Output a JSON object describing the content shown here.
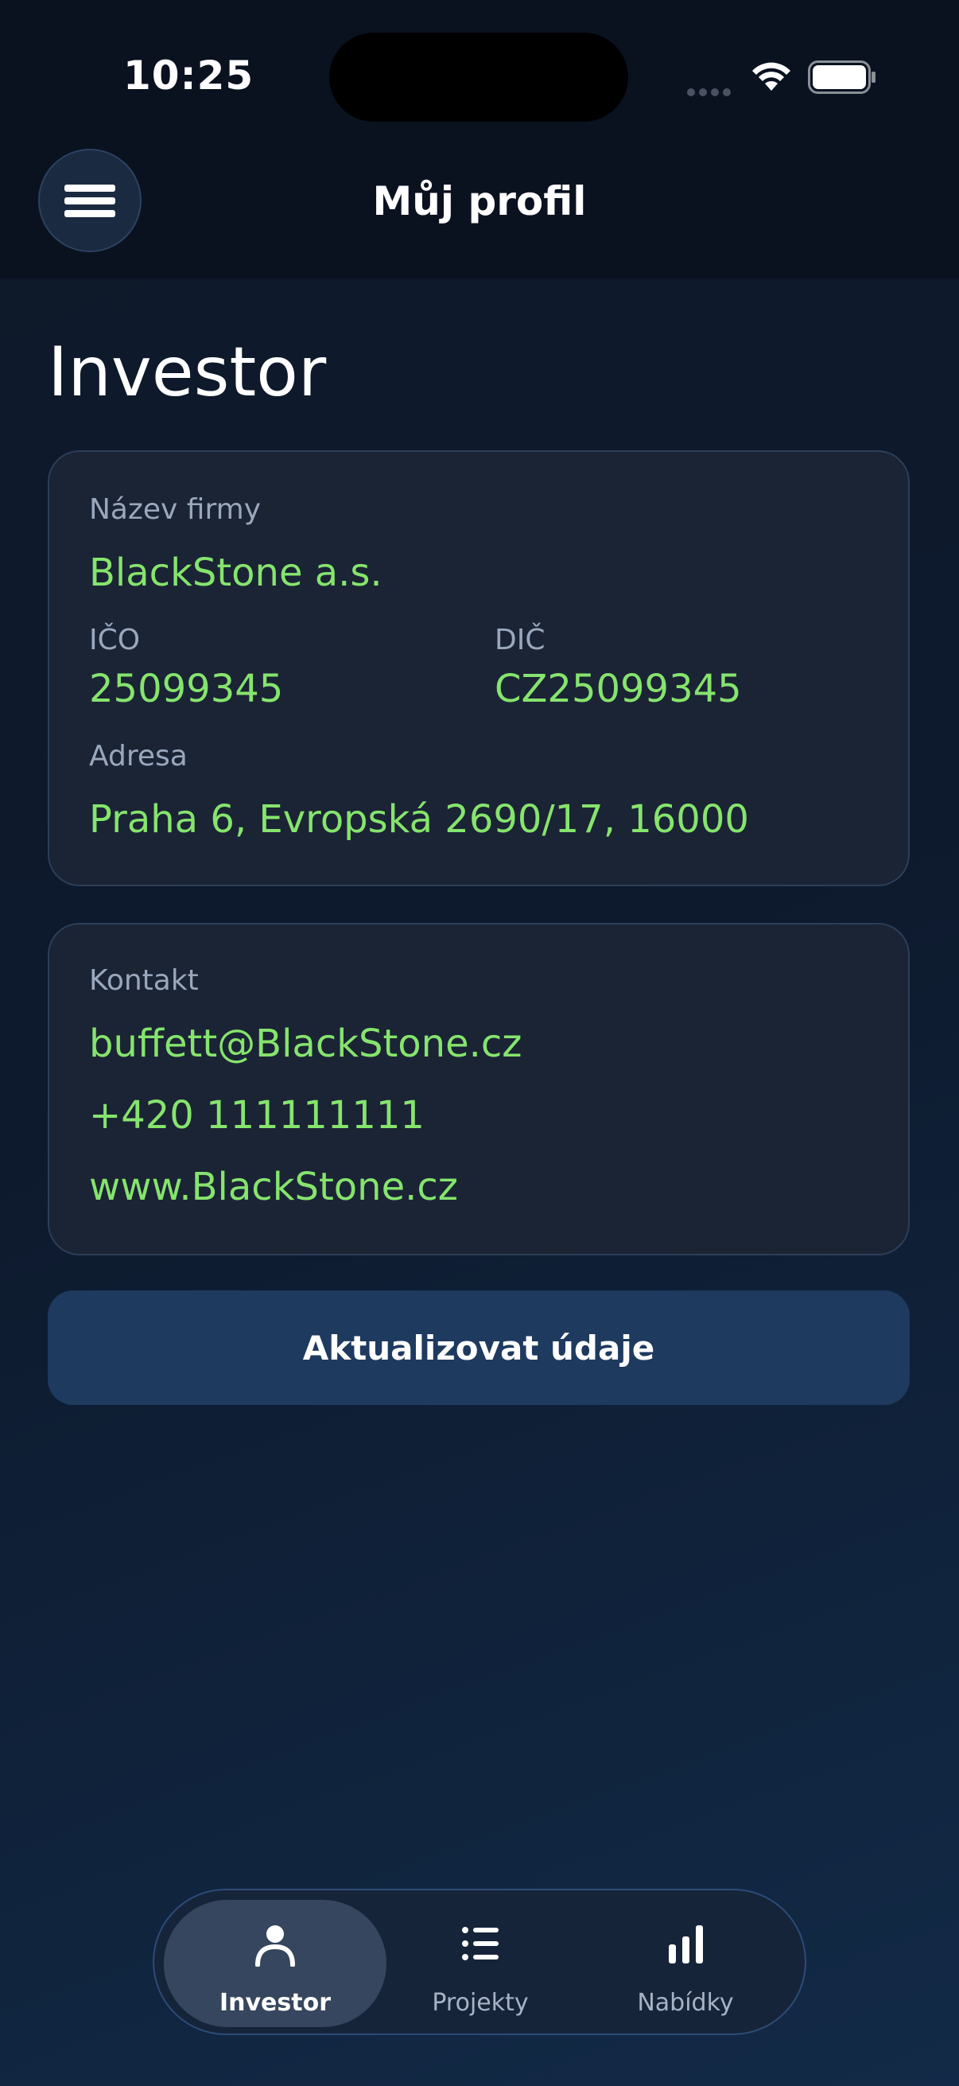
{
  "status_bar": {
    "time": "10:25"
  },
  "header": {
    "title": "Můj profil",
    "menu_icon": "hamburger-menu-icon"
  },
  "main": {
    "heading": "Investor",
    "company_card": {
      "company_name_label": "Název firmy",
      "company_name": "BlackStone a.s.",
      "ico_label": "IČO",
      "ico": "25099345",
      "dic_label": "DIČ",
      "dic": "CZ25099345",
      "address_label": "Adresa",
      "address": "Praha 6, Evropská 2690/17, 16000"
    },
    "contact_card": {
      "label": "Kontakt",
      "email": "buffett@BlackStone.cz",
      "phone": "+420 111111111",
      "website": "www.BlackStone.cz"
    },
    "update_button": "Aktualizovat údaje"
  },
  "tab_bar": {
    "tabs": [
      {
        "label": "Investor",
        "icon": "person-icon",
        "active": true
      },
      {
        "label": "Projekty",
        "icon": "list-icon",
        "active": false
      },
      {
        "label": "Nabídky",
        "icon": "bar-chart-icon",
        "active": false
      }
    ]
  },
  "colors": {
    "accent_value": "#86e46d",
    "card_bg": "#1b2435",
    "button_bg": "#1e3a5f"
  }
}
